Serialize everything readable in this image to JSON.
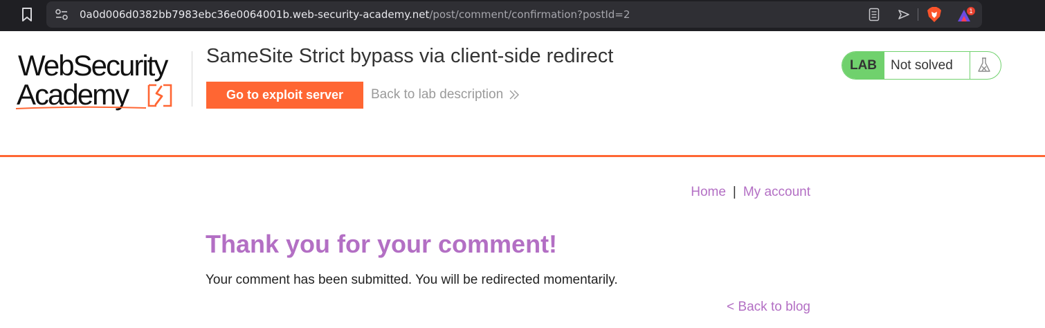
{
  "browser": {
    "url_host": "0a0d006d0382bb7983ebc36e0064001b.web-security-academy.net",
    "url_path": "/post/comment/confirmation?postId=2",
    "notification_count": "1",
    "icons": [
      "bookmark-icon",
      "site-info-icon",
      "reader-mode-icon",
      "send-icon",
      "brave-shield-icon",
      "brave-rewards-icon"
    ]
  },
  "header": {
    "logo_line1": "WebSecurity",
    "logo_line2": "Academy",
    "lab_title": "SameSite Strict bypass via client-side redirect",
    "exploit_button": "Go to exploit server",
    "back_to_lab": "Back to lab description",
    "lab_badge": "LAB",
    "lab_status": "Not solved"
  },
  "nav": {
    "home": "Home",
    "separator": "|",
    "my_account": "My account"
  },
  "main": {
    "heading": "Thank you for your comment!",
    "message": "Your comment has been submitted. You will be redirected momentarily.",
    "back_to_blog": "< Back to blog"
  },
  "colors": {
    "accent_orange": "#ff6633",
    "link_purple": "#b36fc4",
    "lab_green": "#70d16d",
    "chrome_bg": "#1f1f23"
  }
}
